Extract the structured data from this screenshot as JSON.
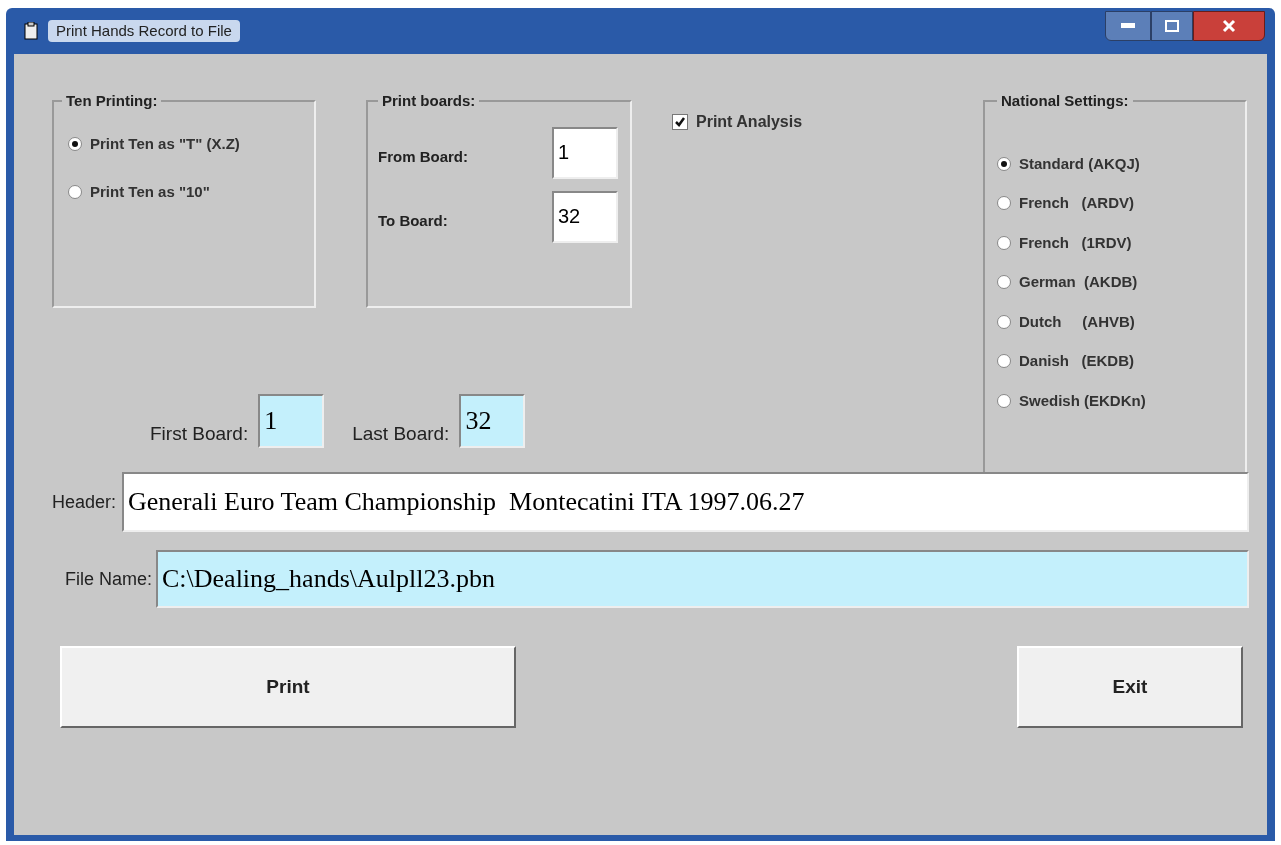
{
  "window": {
    "title": "Print Hands Record to File"
  },
  "ten_printing": {
    "title": "Ten Printing:",
    "options": [
      {
        "label": "Print Ten as \"T\" (X.Z)",
        "selected": true
      },
      {
        "label": "Print Ten as \"10\"",
        "selected": false
      }
    ]
  },
  "print_boards": {
    "title": "Print boards:",
    "from_label": "From Board:",
    "from_value": "1",
    "to_label": "To Board:",
    "to_value": "32"
  },
  "print_analysis": {
    "label": "Print Analysis",
    "checked": true
  },
  "national_settings": {
    "title": "National Settings:",
    "options": [
      {
        "label": "Standard (AKQJ)",
        "selected": true
      },
      {
        "label": "French   (ARDV)",
        "selected": false
      },
      {
        "label": "French   (1RDV)",
        "selected": false
      },
      {
        "label": "German  (AKDB)",
        "selected": false
      },
      {
        "label": "Dutch     (AHVB)",
        "selected": false
      },
      {
        "label": "Danish   (EKDB)",
        "selected": false
      },
      {
        "label": "Swedish (EKDKn)",
        "selected": false
      }
    ]
  },
  "first_board": {
    "label": "First Board:",
    "value": "1"
  },
  "last_board": {
    "label": "Last Board:",
    "value": "32"
  },
  "header": {
    "label": "Header:",
    "value": "Generali Euro Team Championship  Montecatini ITA 1997.06.27"
  },
  "file_name": {
    "label": "File Name:",
    "value": "C:\\Dealing_hands\\Aulpll23.pbn"
  },
  "buttons": [
    "Print",
    "Exit"
  ]
}
